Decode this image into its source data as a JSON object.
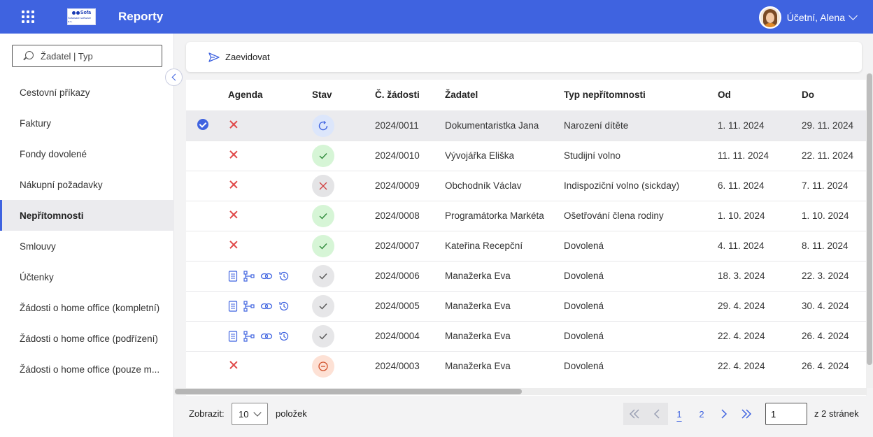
{
  "header": {
    "logo_mark": "Sofa",
    "logo_sub": "Sofaware software a.s.",
    "title": "Reporty",
    "user_name": "Účetní, Alena",
    "accent": "#3f63e0"
  },
  "sidebar": {
    "search_placeholder": "Žadatel | Typ",
    "items": [
      {
        "label": "Cestovní příkazy"
      },
      {
        "label": "Faktury"
      },
      {
        "label": "Fondy dovolené"
      },
      {
        "label": "Nákupní požadavky"
      },
      {
        "label": "Nepřítomnosti",
        "active": true
      },
      {
        "label": "Smlouvy"
      },
      {
        "label": "Účtenky"
      },
      {
        "label": "Žádosti o home office (kompletní)"
      },
      {
        "label": "Žádosti o home office (podřízení)"
      },
      {
        "label": "Žádosti o home office (pouze m..."
      }
    ]
  },
  "toolbar": {
    "register_label": "Zaevidovat"
  },
  "table": {
    "columns": [
      "Agenda",
      "Stav",
      "Č. žádosti",
      "Žadatel",
      "Typ nepřítomnosti",
      "Od",
      "Do"
    ],
    "rows": [
      {
        "selected": true,
        "agenda": "x",
        "status": "progress",
        "number": "2024/0011",
        "applicant": "Dokumentaristka Jana",
        "type": "Narození dítěte",
        "from": "1. 11. 2024",
        "to": "29. 11. 2024"
      },
      {
        "selected": false,
        "agenda": "x",
        "status": "ok",
        "number": "2024/0010",
        "applicant": "Vývojářka Eliška",
        "type": "Studijní volno",
        "from": "11. 11. 2024",
        "to": "22. 11. 2024"
      },
      {
        "selected": false,
        "agenda": "x",
        "status": "rejected",
        "number": "2024/0009",
        "applicant": "Obchodník Václav",
        "type": "Indispoziční volno (sickday)",
        "from": "6. 11. 2024",
        "to": "7. 11. 2024"
      },
      {
        "selected": false,
        "agenda": "x",
        "status": "ok",
        "number": "2024/0008",
        "applicant": "Programátorka Markéta",
        "type": "Ošetřování člena rodiny",
        "from": "1. 10. 2024",
        "to": "1. 10. 2024"
      },
      {
        "selected": false,
        "agenda": "x",
        "status": "ok",
        "number": "2024/0007",
        "applicant": "Kateřina Recepční",
        "type": "Dovolená",
        "from": "4. 11. 2024",
        "to": "8. 11. 2024"
      },
      {
        "selected": false,
        "agenda": "icons",
        "status": "done",
        "number": "2024/0006",
        "applicant": "Manažerka Eva",
        "type": "Dovolená",
        "from": "18. 3. 2024",
        "to": "22. 3. 2024"
      },
      {
        "selected": false,
        "agenda": "icons",
        "status": "done",
        "number": "2024/0005",
        "applicant": "Manažerka Eva",
        "type": "Dovolená",
        "from": "29. 4. 2024",
        "to": "30. 4. 2024"
      },
      {
        "selected": false,
        "agenda": "icons",
        "status": "done",
        "number": "2024/0004",
        "applicant": "Manažerka Eva",
        "type": "Dovolená",
        "from": "22. 4. 2024",
        "to": "26. 4. 2024"
      },
      {
        "selected": false,
        "agenda": "x",
        "status": "cancelled",
        "number": "2024/0003",
        "applicant": "Manažerka Eva",
        "type": "Dovolená",
        "from": "22. 4. 2024",
        "to": "26. 4. 2024"
      }
    ]
  },
  "footer": {
    "show_label": "Zobrazit:",
    "page_size": "10",
    "items_label": "položek",
    "pages": [
      "1",
      "2"
    ],
    "current_page": "1",
    "page_input": "1",
    "total_label": "z 2 stránek"
  }
}
